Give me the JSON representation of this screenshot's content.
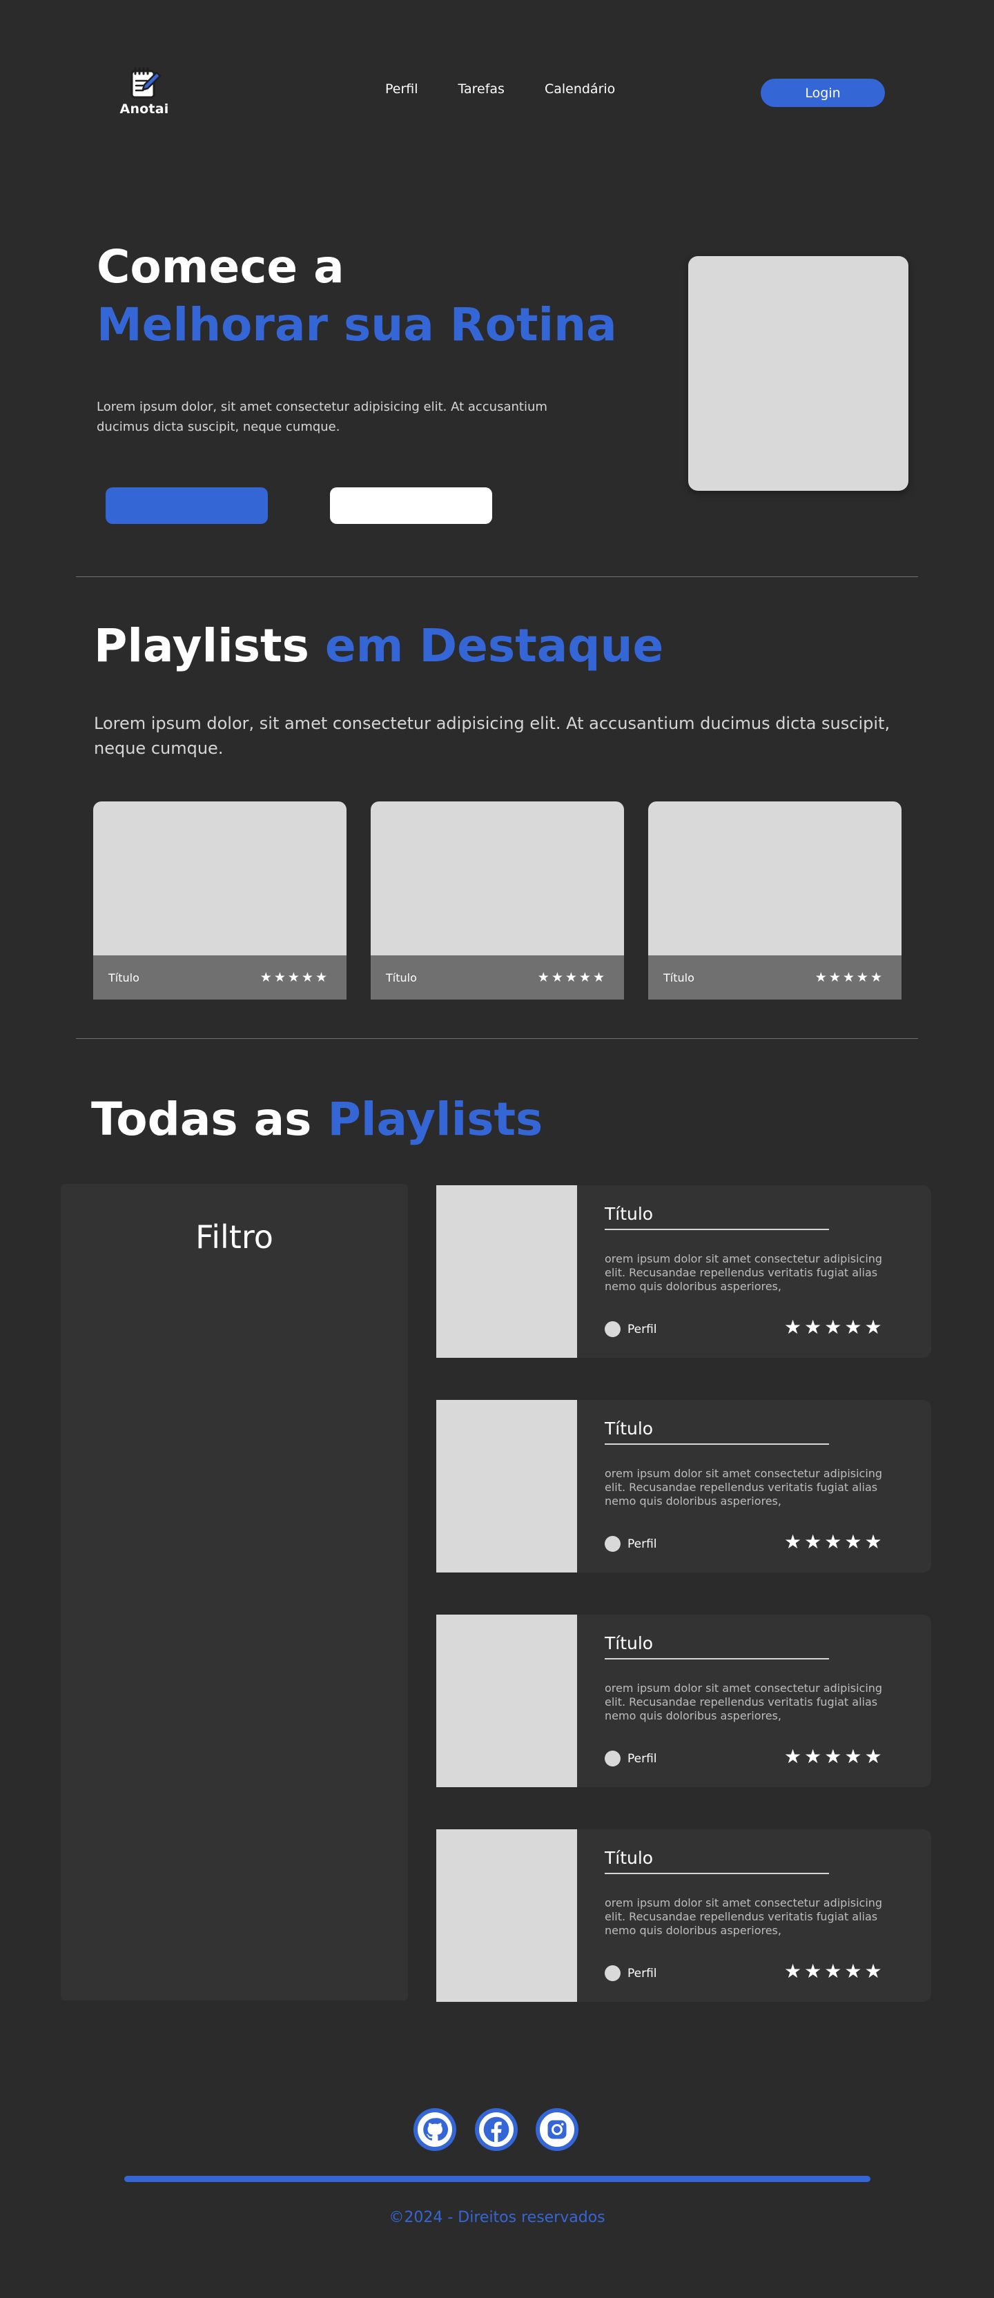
{
  "header": {
    "logo_text": "Anotai",
    "logo_icon": "notepad-pencil-icon",
    "nav": [
      "Perfil",
      "Tarefas",
      "Calendário"
    ],
    "login_label": "Login"
  },
  "hero": {
    "title_line1": "Comece a",
    "title_line2": "Melhorar sua Rotina",
    "text": "Lorem ipsum dolor, sit amet consectetur adipisicing elit. At accusantium ducimus dicta suscipit, neque cumque."
  },
  "featured": {
    "title_white": "Playlists",
    "title_blue": "em Destaque",
    "text": "Lorem ipsum dolor, sit amet consectetur adipisicing elit. At accusantium ducimus dicta suscipit, neque cumque.",
    "cards": [
      {
        "title": "Título",
        "rating": 5
      },
      {
        "title": "Título",
        "rating": 5
      },
      {
        "title": "Título",
        "rating": 5
      }
    ]
  },
  "all": {
    "title_white": "Todas as",
    "title_blue": "Playlists",
    "filter_title": "Filtro",
    "cards": [
      {
        "title": "Título",
        "desc": "orem ipsum dolor sit amet consectetur adipisicing elit. Recusandae repellendus veritatis fugiat alias nemo quis doloribus asperiores,",
        "profile": "Perfil",
        "rating": 5
      },
      {
        "title": "Título",
        "desc": "orem ipsum dolor sit amet consectetur adipisicing elit. Recusandae repellendus veritatis fugiat alias nemo quis doloribus asperiores,",
        "profile": "Perfil",
        "rating": 5
      },
      {
        "title": "Título",
        "desc": "orem ipsum dolor sit amet consectetur adipisicing elit. Recusandae repellendus veritatis fugiat alias nemo quis doloribus asperiores,",
        "profile": "Perfil",
        "rating": 5
      },
      {
        "title": "Título",
        "desc": "orem ipsum dolor sit amet consectetur adipisicing elit. Recusandae repellendus veritatis fugiat alias nemo quis doloribus asperiores,",
        "profile": "Perfil",
        "rating": 5
      }
    ]
  },
  "footer": {
    "social": [
      "github-icon",
      "facebook-icon",
      "instagram-icon"
    ],
    "copyright": "©2024 - Direitos reservados"
  },
  "colors": {
    "background": "#2b2b2b",
    "accent": "#3466d6",
    "panel": "#333333",
    "placeholder": "#d9d9d9"
  }
}
